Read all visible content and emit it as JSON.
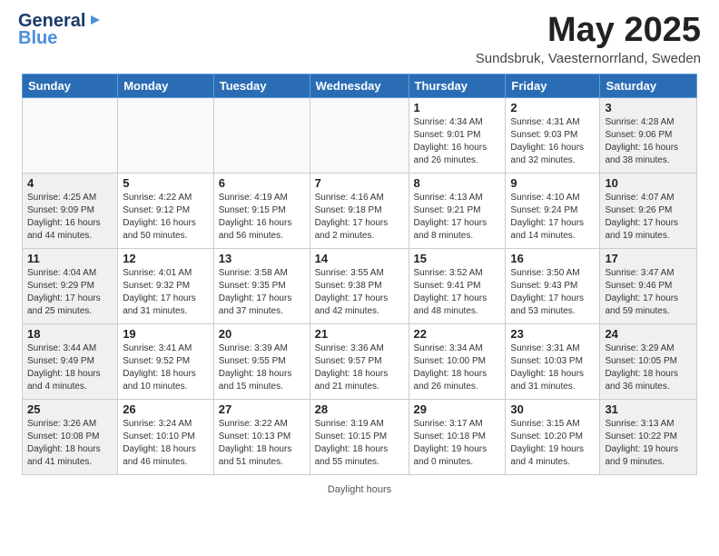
{
  "header": {
    "logo_line1": "General",
    "logo_line2": "Blue",
    "title": "May 2025",
    "subtitle": "Sundsbruk, Vaesternorrland, Sweden"
  },
  "days_of_week": [
    "Sunday",
    "Monday",
    "Tuesday",
    "Wednesday",
    "Thursday",
    "Friday",
    "Saturday"
  ],
  "weeks": [
    [
      {
        "day": "",
        "info": ""
      },
      {
        "day": "",
        "info": ""
      },
      {
        "day": "",
        "info": ""
      },
      {
        "day": "",
        "info": ""
      },
      {
        "day": "1",
        "info": "Sunrise: 4:34 AM\nSunset: 9:01 PM\nDaylight: 16 hours\nand 26 minutes."
      },
      {
        "day": "2",
        "info": "Sunrise: 4:31 AM\nSunset: 9:03 PM\nDaylight: 16 hours\nand 32 minutes."
      },
      {
        "day": "3",
        "info": "Sunrise: 4:28 AM\nSunset: 9:06 PM\nDaylight: 16 hours\nand 38 minutes."
      }
    ],
    [
      {
        "day": "4",
        "info": "Sunrise: 4:25 AM\nSunset: 9:09 PM\nDaylight: 16 hours\nand 44 minutes."
      },
      {
        "day": "5",
        "info": "Sunrise: 4:22 AM\nSunset: 9:12 PM\nDaylight: 16 hours\nand 50 minutes."
      },
      {
        "day": "6",
        "info": "Sunrise: 4:19 AM\nSunset: 9:15 PM\nDaylight: 16 hours\nand 56 minutes."
      },
      {
        "day": "7",
        "info": "Sunrise: 4:16 AM\nSunset: 9:18 PM\nDaylight: 17 hours\nand 2 minutes."
      },
      {
        "day": "8",
        "info": "Sunrise: 4:13 AM\nSunset: 9:21 PM\nDaylight: 17 hours\nand 8 minutes."
      },
      {
        "day": "9",
        "info": "Sunrise: 4:10 AM\nSunset: 9:24 PM\nDaylight: 17 hours\nand 14 minutes."
      },
      {
        "day": "10",
        "info": "Sunrise: 4:07 AM\nSunset: 9:26 PM\nDaylight: 17 hours\nand 19 minutes."
      }
    ],
    [
      {
        "day": "11",
        "info": "Sunrise: 4:04 AM\nSunset: 9:29 PM\nDaylight: 17 hours\nand 25 minutes."
      },
      {
        "day": "12",
        "info": "Sunrise: 4:01 AM\nSunset: 9:32 PM\nDaylight: 17 hours\nand 31 minutes."
      },
      {
        "day": "13",
        "info": "Sunrise: 3:58 AM\nSunset: 9:35 PM\nDaylight: 17 hours\nand 37 minutes."
      },
      {
        "day": "14",
        "info": "Sunrise: 3:55 AM\nSunset: 9:38 PM\nDaylight: 17 hours\nand 42 minutes."
      },
      {
        "day": "15",
        "info": "Sunrise: 3:52 AM\nSunset: 9:41 PM\nDaylight: 17 hours\nand 48 minutes."
      },
      {
        "day": "16",
        "info": "Sunrise: 3:50 AM\nSunset: 9:43 PM\nDaylight: 17 hours\nand 53 minutes."
      },
      {
        "day": "17",
        "info": "Sunrise: 3:47 AM\nSunset: 9:46 PM\nDaylight: 17 hours\nand 59 minutes."
      }
    ],
    [
      {
        "day": "18",
        "info": "Sunrise: 3:44 AM\nSunset: 9:49 PM\nDaylight: 18 hours\nand 4 minutes."
      },
      {
        "day": "19",
        "info": "Sunrise: 3:41 AM\nSunset: 9:52 PM\nDaylight: 18 hours\nand 10 minutes."
      },
      {
        "day": "20",
        "info": "Sunrise: 3:39 AM\nSunset: 9:55 PM\nDaylight: 18 hours\nand 15 minutes."
      },
      {
        "day": "21",
        "info": "Sunrise: 3:36 AM\nSunset: 9:57 PM\nDaylight: 18 hours\nand 21 minutes."
      },
      {
        "day": "22",
        "info": "Sunrise: 3:34 AM\nSunset: 10:00 PM\nDaylight: 18 hours\nand 26 minutes."
      },
      {
        "day": "23",
        "info": "Sunrise: 3:31 AM\nSunset: 10:03 PM\nDaylight: 18 hours\nand 31 minutes."
      },
      {
        "day": "24",
        "info": "Sunrise: 3:29 AM\nSunset: 10:05 PM\nDaylight: 18 hours\nand 36 minutes."
      }
    ],
    [
      {
        "day": "25",
        "info": "Sunrise: 3:26 AM\nSunset: 10:08 PM\nDaylight: 18 hours\nand 41 minutes."
      },
      {
        "day": "26",
        "info": "Sunrise: 3:24 AM\nSunset: 10:10 PM\nDaylight: 18 hours\nand 46 minutes."
      },
      {
        "day": "27",
        "info": "Sunrise: 3:22 AM\nSunset: 10:13 PM\nDaylight: 18 hours\nand 51 minutes."
      },
      {
        "day": "28",
        "info": "Sunrise: 3:19 AM\nSunset: 10:15 PM\nDaylight: 18 hours\nand 55 minutes."
      },
      {
        "day": "29",
        "info": "Sunrise: 3:17 AM\nSunset: 10:18 PM\nDaylight: 19 hours\nand 0 minutes."
      },
      {
        "day": "30",
        "info": "Sunrise: 3:15 AM\nSunset: 10:20 PM\nDaylight: 19 hours\nand 4 minutes."
      },
      {
        "day": "31",
        "info": "Sunrise: 3:13 AM\nSunset: 10:22 PM\nDaylight: 19 hours\nand 9 minutes."
      }
    ]
  ]
}
